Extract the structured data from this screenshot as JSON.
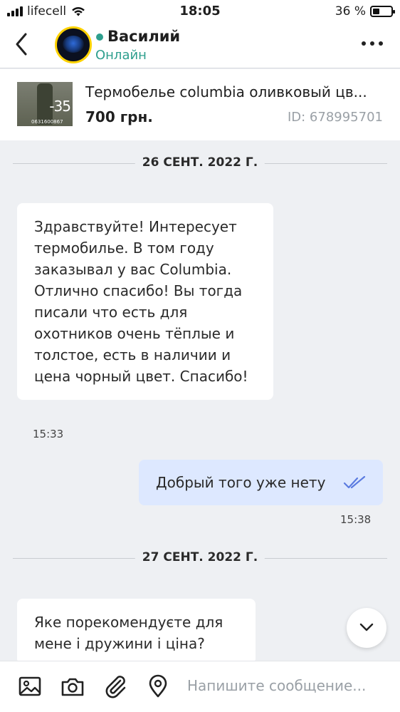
{
  "status_bar": {
    "carrier": "lifecell",
    "time": "18:05",
    "battery": "36 %",
    "battery_level": 0.36
  },
  "header": {
    "contact_name": "Василий",
    "contact_status": "Онлайн",
    "status_color": "#2e9f8e"
  },
  "product": {
    "title": "Термобелье columbia оливковый цв...",
    "price": "700 грн.",
    "id": "ID: 678995701",
    "thumb_tag": "-35",
    "thumb_phone": "0631600867"
  },
  "messages": [
    {
      "date": "26 СЕНТ. 2022 Г."
    },
    {
      "direction": "in",
      "text": "Здравствуйте! Интересует термобилье. В  том году заказывал у вас Columbia. Отлично спасибо! Вы тогда писали что есть для охотников очень тёплые и толстое, есть в наличии и цена чорный цвет. Спасибо!",
      "time": "15:33"
    },
    {
      "direction": "out",
      "text": "Добрый того уже нету",
      "time": "15:38",
      "read": true
    },
    {
      "date": "27 СЕНТ. 2022 Г."
    },
    {
      "direction": "in",
      "text": "Яке порекомендуєте для мене і дружини і ціна?"
    }
  ],
  "composer": {
    "placeholder": "Напишите сообщение..."
  },
  "colors": {
    "accent": "#2e9f8e",
    "outgoing_bubble": "#dde8ff",
    "read_check": "#5b7be0"
  }
}
